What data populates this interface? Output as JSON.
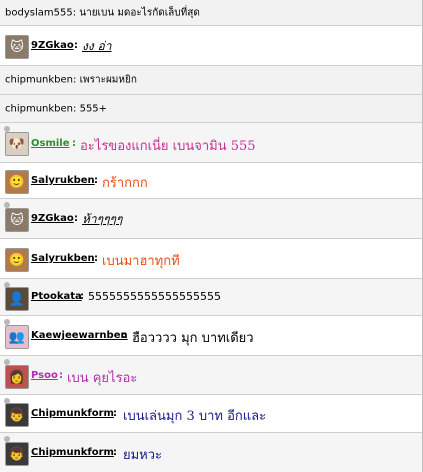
{
  "feed": [
    {
      "kind": "plain",
      "user": "bodyslam555",
      "text": "นายเบน มดอะไรกัดเล็บที่สุด"
    },
    {
      "kind": "post",
      "user": "9ZGkao",
      "text": "งง อ่า",
      "avatar_icon": "cat-avatar-icon"
    },
    {
      "kind": "plain",
      "user": "chipmunkben",
      "text": "เพราะผมหยิก"
    },
    {
      "kind": "plain",
      "user": "chipmunkben",
      "text": "555+"
    },
    {
      "kind": "post",
      "user": "Osmile",
      "text": "อะไรของแกเนี่ย เบนจามิน 555",
      "avatar_icon": "dog-avatar-icon",
      "user_color": "#2e8b2e",
      "text_color": "#cc2e8e"
    },
    {
      "kind": "post",
      "user": "Salyrukben",
      "text": "กร้ากกก",
      "avatar_icon": "face-avatar-icon",
      "user_color": "#000000",
      "text_color": "#e85010"
    },
    {
      "kind": "post",
      "user": "9ZGkao",
      "text": "ห้าๆๆๆๆ",
      "avatar_icon": "cat-avatar-icon"
    },
    {
      "kind": "post",
      "user": "Salyrukben",
      "text": "เบนมาฮาทุกที",
      "avatar_icon": "face-avatar-icon",
      "user_color": "#000000",
      "text_color": "#e85010"
    },
    {
      "kind": "post",
      "user": "Ptookata",
      "text": "5555555555555555555",
      "avatar_icon": "photo-avatar-icon",
      "user_color": "#000000",
      "text_color": "#000000"
    },
    {
      "kind": "post",
      "user": "Kaewjeewarnben",
      "text": "ฮือวววว มุก บาทเดียว",
      "avatar_icon": "group-avatar-icon",
      "user_color": "#000000",
      "text_color": "#000000"
    },
    {
      "kind": "post",
      "user": "Psoo",
      "text": "เบน คุยไรอะ",
      "avatar_icon": "girl-avatar-icon",
      "user_color": "#b030b0",
      "text_color": "#b030b0"
    },
    {
      "kind": "post",
      "user": "Chipmunkform",
      "text": "เบนเล่นมุก 3 บาท อีกและ",
      "avatar_icon": "person-avatar-icon",
      "user_color": "#000000",
      "text_color": "#1a1a8c"
    },
    {
      "kind": "post",
      "user": "Chipmunkform",
      "text": "ยมหวะ",
      "avatar_icon": "person-avatar-icon",
      "user_color": "#000000",
      "text_color": "#1a1a8c"
    }
  ],
  "colors": {
    "row_border": "#cfcfcf",
    "plain_bg": "#f2f2f2"
  }
}
